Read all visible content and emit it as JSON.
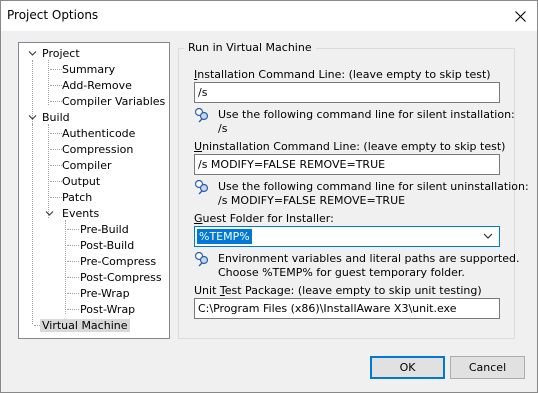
{
  "window": {
    "title": "Project Options",
    "close_glyph": "close-icon"
  },
  "tree": {
    "items": [
      {
        "label": "Project",
        "level": 0,
        "expanded": true
      },
      {
        "label": "Summary",
        "level": 1
      },
      {
        "label": "Add-Remove",
        "level": 1
      },
      {
        "label": "Compiler Variables",
        "level": 1
      },
      {
        "label": "Build",
        "level": 0,
        "expanded": true
      },
      {
        "label": "Authenticode",
        "level": 1
      },
      {
        "label": "Compression",
        "level": 1
      },
      {
        "label": "Compiler",
        "level": 1
      },
      {
        "label": "Output",
        "level": 1
      },
      {
        "label": "Patch",
        "level": 1
      },
      {
        "label": "Events",
        "level": 1,
        "expanded": true
      },
      {
        "label": "Pre-Build",
        "level": 2
      },
      {
        "label": "Post-Build",
        "level": 2
      },
      {
        "label": "Pre-Compress",
        "level": 2
      },
      {
        "label": "Post-Compress",
        "level": 2
      },
      {
        "label": "Pre-Wrap",
        "level": 2
      },
      {
        "label": "Post-Wrap",
        "level": 2
      },
      {
        "label": "Virtual Machine",
        "level": 0,
        "selected": true
      }
    ]
  },
  "panel": {
    "group_title": "Run in Virtual Machine",
    "install": {
      "label_first": "I",
      "label_rest": "nstallation Command Line: (leave empty to skip test)",
      "value": "/s",
      "hint_line1": "Use the following command line for silent installation:",
      "hint_line2": "/s"
    },
    "uninstall": {
      "label_first": "U",
      "label_rest": "ninstallation Command Line: (leave empty to skip test)",
      "value": "/s MODIFY=FALSE REMOVE=TRUE",
      "hint_line1": "Use the following command line for silent uninstallation:",
      "hint_line2": "/s MODIFY=FALSE REMOVE=TRUE"
    },
    "guest": {
      "label_first": "G",
      "label_rest": "uest Folder for Installer:",
      "value": "%TEMP%",
      "hint_line1": "Environment variables and literal paths are supported.",
      "hint_line2": "Choose %TEMP% for guest temporary folder."
    },
    "unit": {
      "label_before": "Unit ",
      "label_first": "T",
      "label_rest": "est Package: (leave empty to skip unit testing)",
      "value": "C:\\Program Files (x86)\\InstallAware X3\\unit.exe"
    }
  },
  "buttons": {
    "ok": "OK",
    "cancel": "Cancel"
  },
  "colors": {
    "accent": "#0078d7",
    "window_bg": "#f0f0f0"
  }
}
